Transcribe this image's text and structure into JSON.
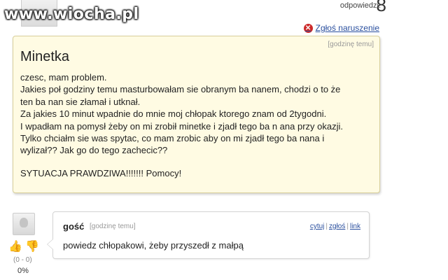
{
  "watermark": "www.wiocha.pl",
  "header": {
    "answers_label": "odpowiedzi:",
    "answers_count": "8",
    "report_label": "Zgłoś naruszenie"
  },
  "question": {
    "time": "[godzinę temu]",
    "title": "Minetka",
    "lines": [
      "czesc, mam problem.",
      "Jakies poł godziny temu masturbowałam sie obranym ba nanem, chodzi o to że",
      "ten ba nan sie złamał i utknał.",
      "Za jakies 10 minut wpadnie do mnie moj chłopak ktorego znam od 2tygodni.",
      "I wpadłam na pomysł żeby on mi zrobił minetke i zjadł tego ba n ana przy okazji.",
      "Tylko chciałm sie was spytac, co mam zrobic aby on mi zjadł tego ba nana i",
      "wylizał?? Jak go do tego zachecic??",
      "",
      "SYTUACJA PRAWDZIWA!!!!!!! Pomocy!"
    ]
  },
  "answer": {
    "author": "gość",
    "time": "[godzinę temu]",
    "actions": {
      "quote": "cytuj",
      "report": "zgłoś",
      "link": "link"
    },
    "body": "powiedz chłopakowi, żeby przyszedł z małpą",
    "votes": {
      "score": "(0 - 0)",
      "percent": "0%"
    }
  },
  "colors": {
    "question_bg": "#fffbe3",
    "link": "#2a4f9e",
    "report_icon": "#cc2a2a"
  },
  "icons": {
    "report": "x-circle-icon",
    "vote_up": "thumbs-up-icon",
    "vote_down": "thumbs-down-icon"
  }
}
